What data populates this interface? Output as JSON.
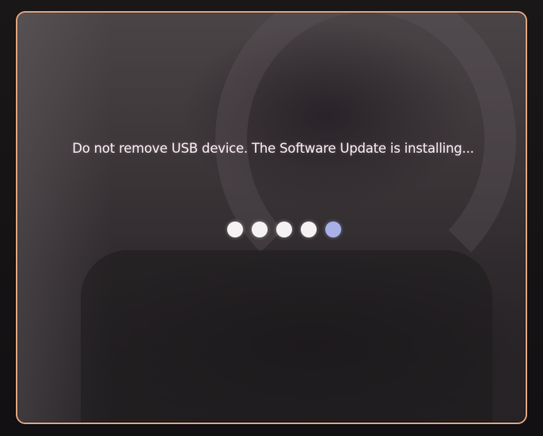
{
  "update_screen": {
    "message": "Do not remove USB device. The Software Update is installing...",
    "progress": {
      "total_steps": 5,
      "active_step": 5
    },
    "colors": {
      "border": "#d9a07a",
      "dot": "#f5f2f4",
      "dot_active": "#a9b0e6",
      "text": "#f3e9ee"
    }
  }
}
